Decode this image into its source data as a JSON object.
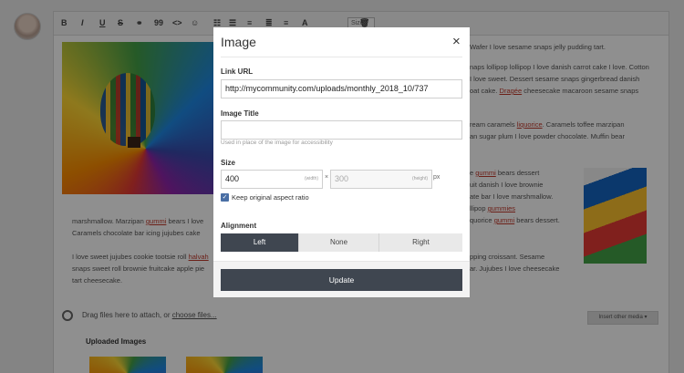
{
  "toolbar": {
    "bold": "B",
    "italic": "I",
    "underline": "U",
    "strike": "S",
    "link": "⚭",
    "quote": "99",
    "code": "<>",
    "emoji": "☺",
    "list_bullet": "☷",
    "list_number": "☰",
    "align": "≡",
    "align_center": "≣",
    "align_right": "≡",
    "font_color": "A",
    "size": "Size",
    "trash": "🗑"
  },
  "background_text": {
    "line_r1": "Wafer I love sesame snaps jelly pudding tart.",
    "line_r2": "naps lollipop lollipop I love danish carrot cake I love. Cotton",
    "line_r3": "I love sweet. Dessert sesame snaps gingerbread danish",
    "line_r4a": "oat cake. ",
    "line_r4_link": "Dragée",
    "line_r4b": " cheesecake macaroon sesame snaps",
    "line_r5a": "ream caramels ",
    "line_r5_link": "liquorice",
    "line_r5b": ". Caramels toffee marzipan",
    "line_r6": "an sugar plum I love powder chocolate. Muffin bear",
    "line_r7a": "e ",
    "line_r7_link": "gummi",
    "line_r7b": " bears dessert",
    "line_r8": "uit danish I love brownie",
    "line_r9": "ate bar I love marshmallow.",
    "line_r10a": "llipop ",
    "line_r10_link": "gummies",
    "line_r11a": "quorice ",
    "line_r11_link": "gummi",
    "line_r11b": " bears dessert.",
    "line_l1a": "marshmallow. Marzipan ",
    "line_l1_link": "gummi",
    "line_l1b": " bears I love",
    "line_l2": "Caramels chocolate bar icing jujubes cake",
    "line_l3a": "I love sweet jujubes cookie tootsie roll ",
    "line_l3_link": "halvah",
    "line_l4": "snaps sweet roll brownie fruitcake apple pie",
    "line_l5": "tart cheesecake.",
    "line_r12": "pping croissant. Sesame",
    "line_r13": "ar. Jujubes I love cheesecake"
  },
  "attach": {
    "text": "Drag files here to attach, or ",
    "link": "choose files..."
  },
  "insert_media": "Insert other media ▾",
  "uploaded_images": "Uploaded Images",
  "modal": {
    "title": "Image",
    "close": "×",
    "link_url_label": "Link URL",
    "link_url_value": "http://mycommunity.com/uploads/monthly_2018_10/737",
    "image_title_label": "Image Title",
    "image_title_value": "",
    "image_title_hint": "Used in place of the image for accessibility",
    "size_label": "Size",
    "width_value": "400",
    "width_unit": "(width)",
    "height_value": "300",
    "height_unit": "(height)",
    "times": "×",
    "px": "px",
    "keep_ratio_label": "Keep original aspect ratio",
    "keep_ratio_checked": true,
    "check_mark": "✓",
    "alignment_label": "Alignment",
    "alignment_options": [
      "Left",
      "None",
      "Right"
    ],
    "alignment_selected": "Left",
    "update_label": "Update"
  }
}
